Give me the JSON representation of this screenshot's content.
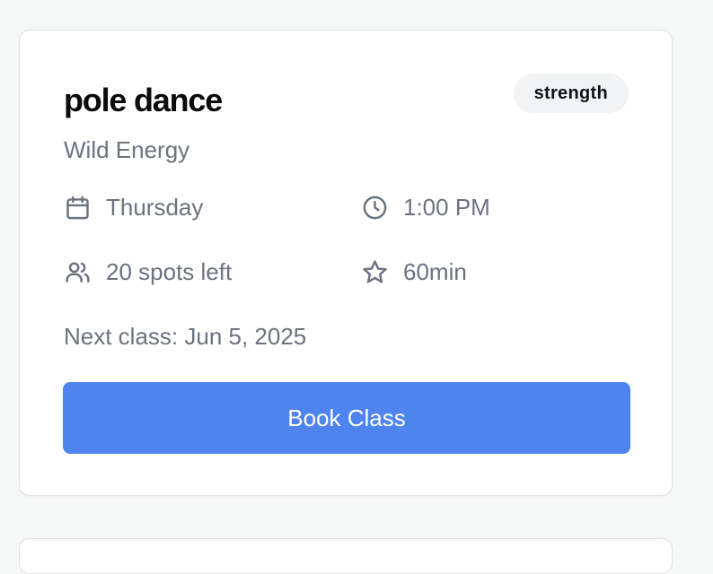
{
  "class_card": {
    "title": "pole dance",
    "category_badge": "strength",
    "studio": "Wild Energy",
    "day": "Thursday",
    "time": "1:00 PM",
    "spots": "20 spots left",
    "duration": "60min",
    "next_class": "Next class: Jun 5, 2025",
    "book_label": "Book Class"
  },
  "icons": {
    "day": "calendar-icon",
    "time": "clock-icon",
    "spots": "users-icon",
    "duration": "star-icon"
  },
  "colors": {
    "accent": "#4f83ed",
    "muted_text": "#6b7280",
    "badge_bg": "#f2f3f5",
    "page_bg": "#f6f7f7"
  }
}
